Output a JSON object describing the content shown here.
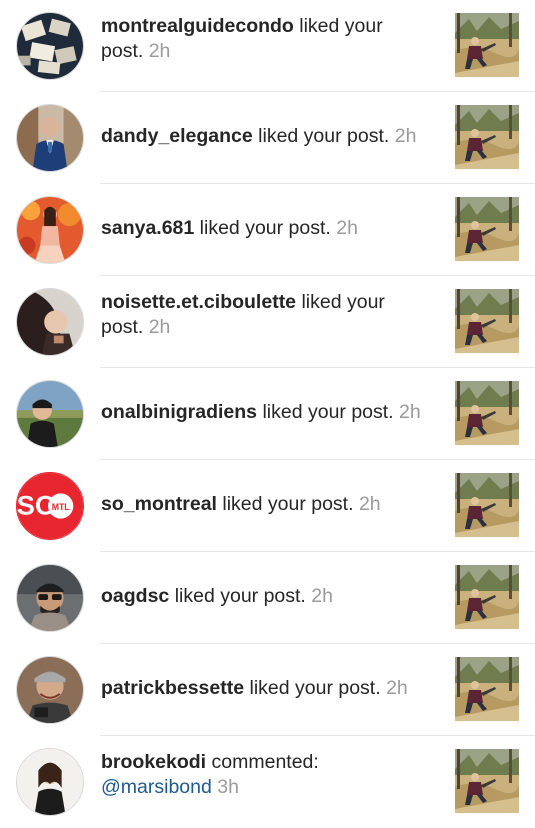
{
  "notifications": [
    {
      "username": "montrealguidecondo",
      "action": " liked your",
      "action2": "post.",
      "time": " 2h",
      "mention": ""
    },
    {
      "username": "dandy_elegance",
      "action": " liked your post.",
      "action2": "",
      "time": " 2h",
      "mention": ""
    },
    {
      "username": "sanya.681",
      "action": " liked your post.",
      "action2": "",
      "time": " 2h",
      "mention": ""
    },
    {
      "username": "noisette.et.ciboulette",
      "action": " liked your",
      "action2": "post.",
      "time": " 2h",
      "mention": ""
    },
    {
      "username": "onalbinigradiens",
      "action": " liked your post.",
      "action2": "",
      "time": " 2h",
      "mention": ""
    },
    {
      "username": "so_montreal",
      "action": " liked your post.",
      "action2": "",
      "time": " 2h",
      "mention": "",
      "avatar_text": "SO",
      "avatar_badge": "MTL"
    },
    {
      "username": "oagdsc",
      "action": " liked your post.",
      "action2": "",
      "time": " 2h",
      "mention": ""
    },
    {
      "username": "patrickbessette",
      "action": " liked your post.",
      "action2": "",
      "time": " 2h",
      "mention": ""
    },
    {
      "username": "brookekodi",
      "action": " commented:",
      "action2": "",
      "time": " 3h",
      "mention": "@marsibond"
    }
  ],
  "colors": {
    "username": "#262626",
    "timestamp": "#9a9a9a",
    "mention": "#1f5a8c",
    "so_montreal_red": "#e8262f"
  }
}
